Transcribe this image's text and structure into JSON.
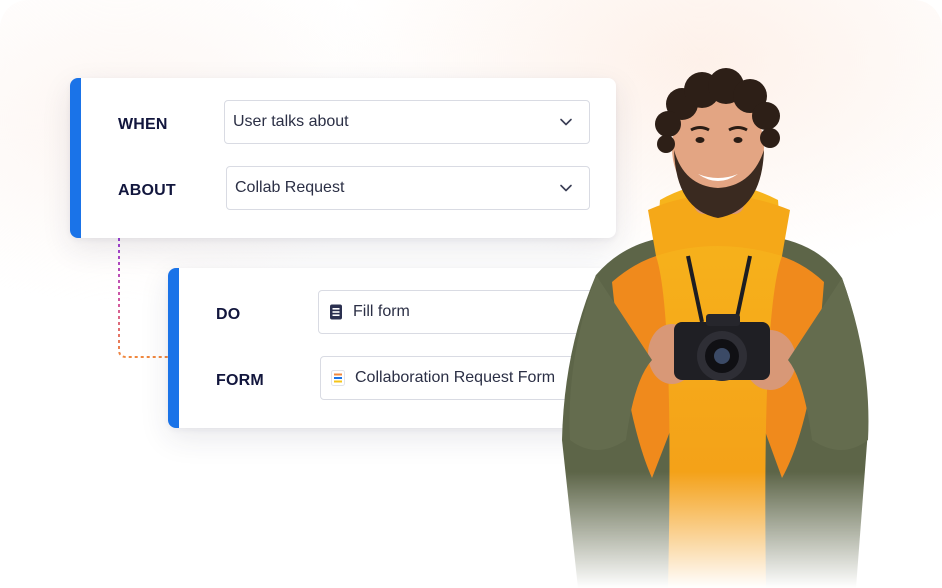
{
  "colors": {
    "accent_blue": "#1a73e8",
    "label_navy": "#12163d",
    "connector_purple": "#9b3fd6",
    "connector_orange": "#f0883e"
  },
  "when_card": {
    "when_label": "WHEN",
    "when_value": "User talks about",
    "about_label": "ABOUT",
    "about_value": "Collab Request"
  },
  "do_card": {
    "do_label": "DO",
    "do_value": "Fill form",
    "do_icon": "document-icon",
    "form_label": "FORM",
    "form_value": "Collaboration Request Form",
    "form_icon": "form-icon"
  },
  "illustration": {
    "subject": "person-holding-camera"
  }
}
